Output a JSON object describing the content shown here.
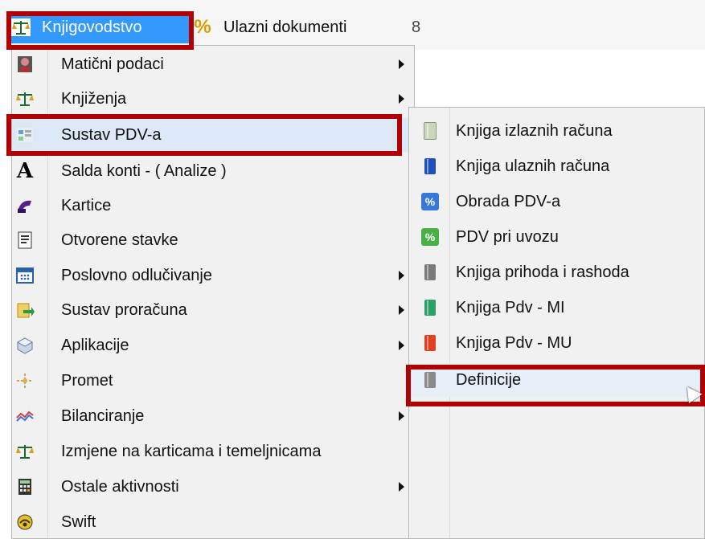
{
  "menubar": {
    "items": [
      {
        "label": "Knjigovodstvo",
        "icon": "scale-icon"
      },
      {
        "label": "Ulazni dokumenti",
        "icon": "percent-icon"
      },
      {
        "label": "8"
      }
    ]
  },
  "menu": {
    "items": [
      {
        "label": "Matični podaci",
        "icon": "person-icon",
        "submenu": true
      },
      {
        "label": "Knjiženja",
        "icon": "scale-icon",
        "submenu": true
      },
      {
        "label": "Sustav PDV-a",
        "icon": "tax-icon",
        "submenu": false,
        "highlighted": true
      },
      {
        "label": "Salda konti - ( Analize )",
        "icon": "letter-a-icon",
        "submenu": false
      },
      {
        "label": "Kartice",
        "icon": "card-icon",
        "submenu": false
      },
      {
        "label": "Otvorene stavke",
        "icon": "document-icon",
        "submenu": false
      },
      {
        "label": "Poslovno odlučivanje",
        "icon": "grid-icon",
        "submenu": true
      },
      {
        "label": "Sustav proračuna",
        "icon": "budget-icon",
        "submenu": true
      },
      {
        "label": "Aplikacije",
        "icon": "box-icon",
        "submenu": true
      },
      {
        "label": "Promet",
        "icon": "traffic-icon",
        "submenu": false
      },
      {
        "label": "Bilanciranje",
        "icon": "chart-icon",
        "submenu": true
      },
      {
        "label": "Izmjene na karticama i temeljnicama",
        "icon": "scale-icon",
        "submenu": false
      },
      {
        "label": "Ostale aktivnosti",
        "icon": "calculator-icon",
        "submenu": true
      },
      {
        "label": "Swift",
        "icon": "swift-icon",
        "submenu": false
      }
    ]
  },
  "submenu": {
    "items": [
      {
        "label": "Knjiga izlaznih računa",
        "icon": "book-icon",
        "color": "#c8d8b8"
      },
      {
        "label": "Knjiga ulaznih računa",
        "icon": "book-icon",
        "color": "#1f4fb8"
      },
      {
        "label": "Obrada PDV-a",
        "icon": "percent-icon",
        "color": "#3a78d8"
      },
      {
        "label": "PDV pri uvozu",
        "icon": "percent-icon",
        "color": "#46b046"
      },
      {
        "label": "Knjiga prihoda i rashoda",
        "icon": "book-icon",
        "color": "#7a7a7a"
      },
      {
        "label": "Knjiga Pdv - MI",
        "icon": "book-icon",
        "color": "#2aa064"
      },
      {
        "label": "Knjiga Pdv - MU",
        "icon": "book-icon",
        "color": "#e04020"
      },
      {
        "label": "Definicije",
        "icon": "book-icon",
        "color": "#8a8a8a",
        "highlighted": true
      }
    ]
  },
  "colors": {
    "highlight": "#3399ff",
    "annotation": "#b00000"
  }
}
